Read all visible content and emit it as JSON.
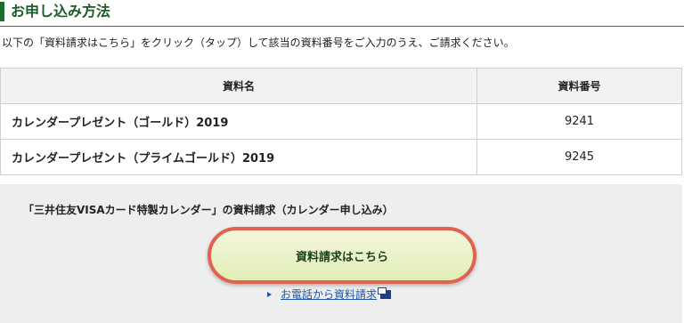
{
  "heading": {
    "title": "お申し込み方法"
  },
  "intro": "以下の「資料請求はこちら」をクリック（タップ）して該当の資料番号をご入力のうえ、ご請求ください。",
  "table": {
    "headers": [
      "資料名",
      "資料番号"
    ],
    "rows": [
      {
        "name": "カレンダープレゼント（ゴールド）2019",
        "number": "9241"
      },
      {
        "name": "カレンダープレゼント（プライムゴールド）2019",
        "number": "9245"
      }
    ]
  },
  "request": {
    "title": "「三井住友VISAカード特製カレンダー」の資料請求（カレンダー申し込み）",
    "button_label": "資料請求はこちら",
    "phone_link": "お電話から資料請求",
    "colors": {
      "button_border": "#e06350",
      "button_fill": "#e9f1c4",
      "link": "#1f57a7"
    },
    "icons": [
      "triangle-bullet-icon",
      "new-window-icon"
    ]
  }
}
